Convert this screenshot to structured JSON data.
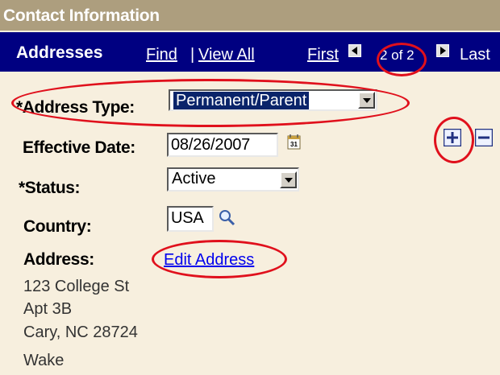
{
  "section": {
    "title": "Contact Information"
  },
  "nav": {
    "title": "Addresses",
    "find": "Find",
    "separator": "|",
    "view_all": "View All",
    "first": "First",
    "page_count": "2 of 2",
    "last": "Last"
  },
  "form": {
    "address_type": {
      "label": "*Address Type:",
      "value": "Permanent/Parent"
    },
    "effective_date": {
      "label": "Effective Date:",
      "value": "08/26/2007",
      "calendar_day": "31"
    },
    "status": {
      "label": "*Status:",
      "value": "Active"
    },
    "country": {
      "label": "Country:",
      "value": "USA"
    },
    "address": {
      "label": "Address:",
      "edit_link": "Edit Address",
      "lines": [
        "123 College St",
        "Apt 3B",
        "Cary, NC 28724",
        "Wake"
      ]
    }
  },
  "row_buttons": {
    "add": "+",
    "delete": "−"
  },
  "icons": {
    "prev": "arrow-left-icon",
    "next": "arrow-right-icon",
    "calendar": "calendar-icon",
    "lookup": "magnifier-icon",
    "add": "plus-icon",
    "delete": "minus-icon"
  },
  "colors": {
    "nav_bg": "#000081",
    "title_bg": "#ad9e7e",
    "page_bg": "#f7efde",
    "annotation": "#e0101c",
    "link": "#0000ee"
  }
}
